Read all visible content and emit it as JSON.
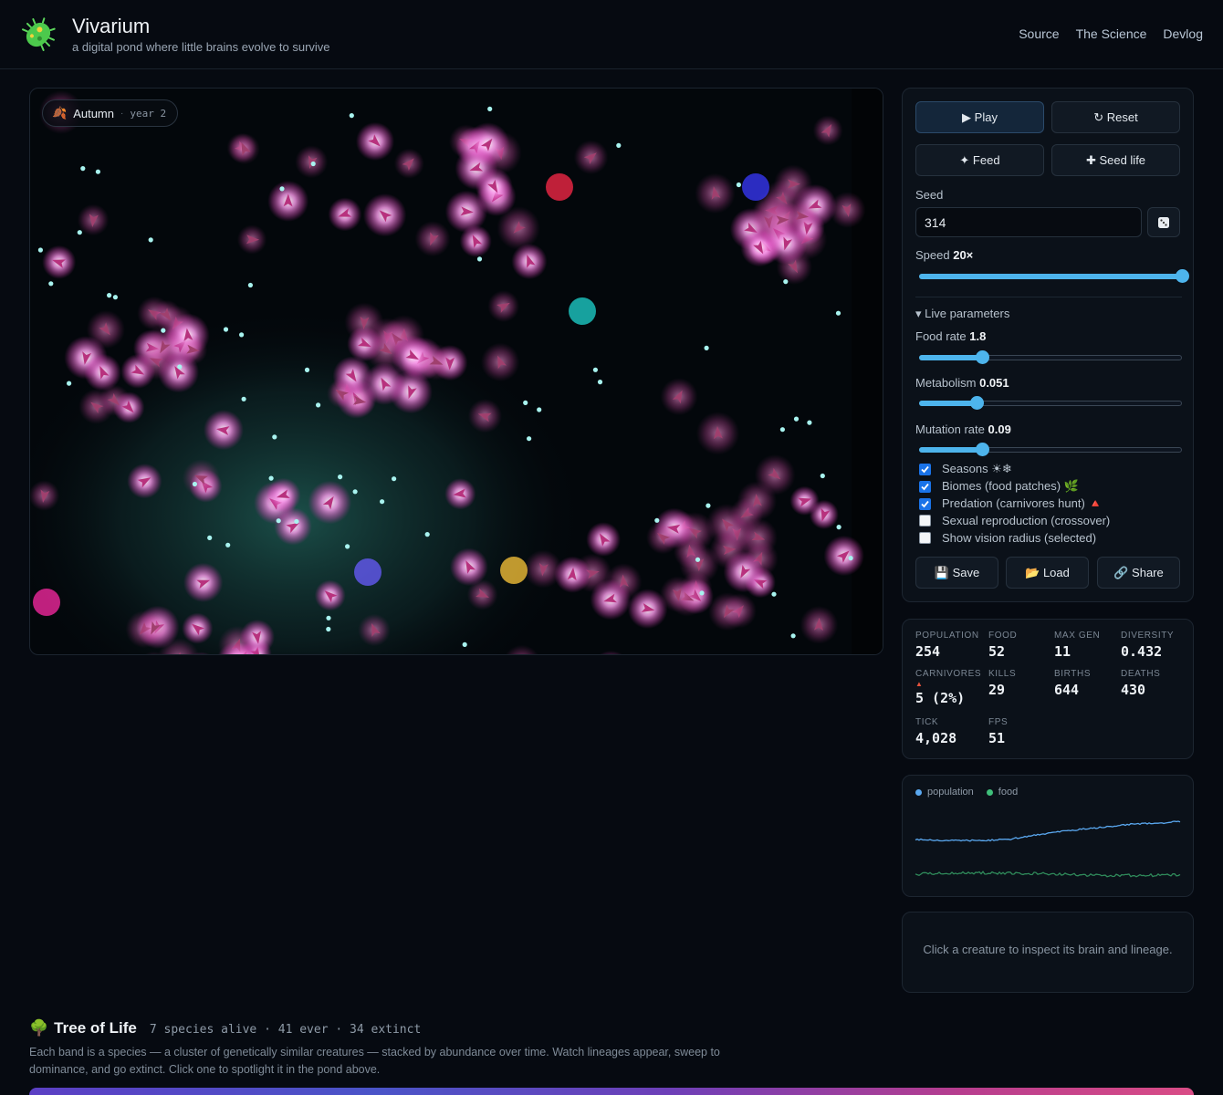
{
  "header": {
    "title": "Vivarium",
    "subtitle": "a digital pond where little brains evolve to survive",
    "nav": [
      "Source",
      "The Science",
      "Devlog"
    ]
  },
  "pond": {
    "season": "Autumn",
    "year": "year 2",
    "creature_color": "#f25fd0",
    "food_color": "#a8f3ef"
  },
  "controls": {
    "play": "▶ Play",
    "reset": "↻ Reset",
    "feed": "✦ Feed",
    "seed_life": "✚ Seed life",
    "seed_label": "Seed",
    "seed_value": "314",
    "speed_label": "Speed",
    "speed_value": "20×",
    "speed_fraction": 1.0,
    "live_params": "▾ Live parameters",
    "food_rate_label": "Food rate",
    "food_rate": "1.8",
    "food_rate_fraction": 0.24,
    "metabolism_label": "Metabolism",
    "metabolism": "0.051",
    "metabolism_fraction": 0.22,
    "mutation_label": "Mutation rate",
    "mutation": "0.09",
    "mutation_fraction": 0.24,
    "checks": [
      {
        "label": "Seasons ☀❄",
        "checked": true
      },
      {
        "label": "Biomes (food patches) 🌿",
        "checked": true
      },
      {
        "label": "Predation (carnivores hunt) 🔺",
        "checked": true
      },
      {
        "label": "Sexual reproduction (crossover)",
        "checked": false
      },
      {
        "label": "Show vision radius (selected)",
        "checked": false
      }
    ],
    "save": "💾 Save",
    "load": "📂 Load",
    "share": "🔗 Share"
  },
  "stats": {
    "population_label": "POPULATION",
    "population": "254",
    "food_label": "FOOD",
    "food": "52",
    "maxgen_label": "MAX GEN",
    "maxgen": "11",
    "diversity_label": "DIVERSITY",
    "diversity": "0.432",
    "carnivores_label": "CARNIVORES",
    "carnivores": "5 (2%)",
    "kills_label": "KILLS",
    "kills": "29",
    "births_label": "BIRTHS",
    "births": "644",
    "deaths_label": "DEATHS",
    "deaths": "430",
    "tick_label": "TICK",
    "tick": "4,028",
    "fps_label": "FPS",
    "fps": "51"
  },
  "graph": {
    "population_label": "population",
    "food_label": "food",
    "population_color": "#5aa8f0",
    "food_color": "#3fbf7a"
  },
  "inspect": {
    "hint": "Click a creature to inspect its brain and lineage."
  },
  "tree": {
    "title": "Tree of Life",
    "meta": "7 species alive · 41 ever · 34 extinct",
    "description": "Each band is a species — a cluster of genetically similar creatures — stacked by abundance over time. Watch lineages appear, sweep to dominance, and go extinct. Click one to spotlight it in the pond above."
  }
}
